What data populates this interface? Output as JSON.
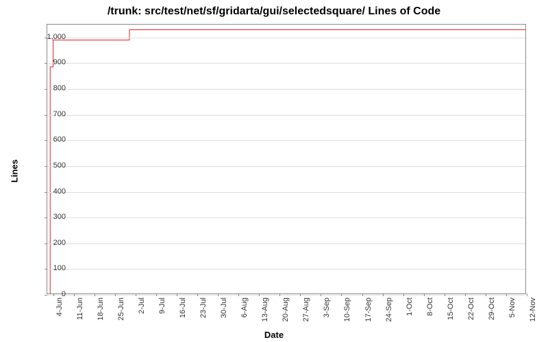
{
  "chart_data": {
    "type": "line",
    "title": "/trunk: src/test/net/sf/gridarta/gui/selectedsquare/ Lines of Code",
    "xlabel": "Date",
    "ylabel": "Lines",
    "ylim": [
      0,
      1050
    ],
    "xlim": [
      "2-Jun",
      "12-Nov"
    ],
    "x_ticks": [
      "4-Jun",
      "11-Jun",
      "18-Jun",
      "25-Jun",
      "2-Jul",
      "9-Jul",
      "16-Jul",
      "23-Jul",
      "30-Jul",
      "6-Aug",
      "13-Aug",
      "20-Aug",
      "27-Aug",
      "3-Sep",
      "10-Sep",
      "17-Sep",
      "24-Sep",
      "1-Oct",
      "8-Oct",
      "15-Oct",
      "22-Oct",
      "29-Oct",
      "5-Nov",
      "12-Nov"
    ],
    "y_ticks": [
      0,
      100,
      200,
      300,
      400,
      500,
      600,
      700,
      800,
      900,
      1000
    ],
    "series": [
      {
        "name": "Lines",
        "color": "#e02020",
        "points": [
          {
            "x": "3-Jun",
            "y": 0
          },
          {
            "x": "3-Jun",
            "y": 885
          },
          {
            "x": "4-Jun",
            "y": 885
          },
          {
            "x": "4-Jun",
            "y": 990
          },
          {
            "x": "30-Jun",
            "y": 990
          },
          {
            "x": "30-Jun",
            "y": 1030
          },
          {
            "x": "12-Nov",
            "y": 1030
          }
        ]
      }
    ]
  }
}
